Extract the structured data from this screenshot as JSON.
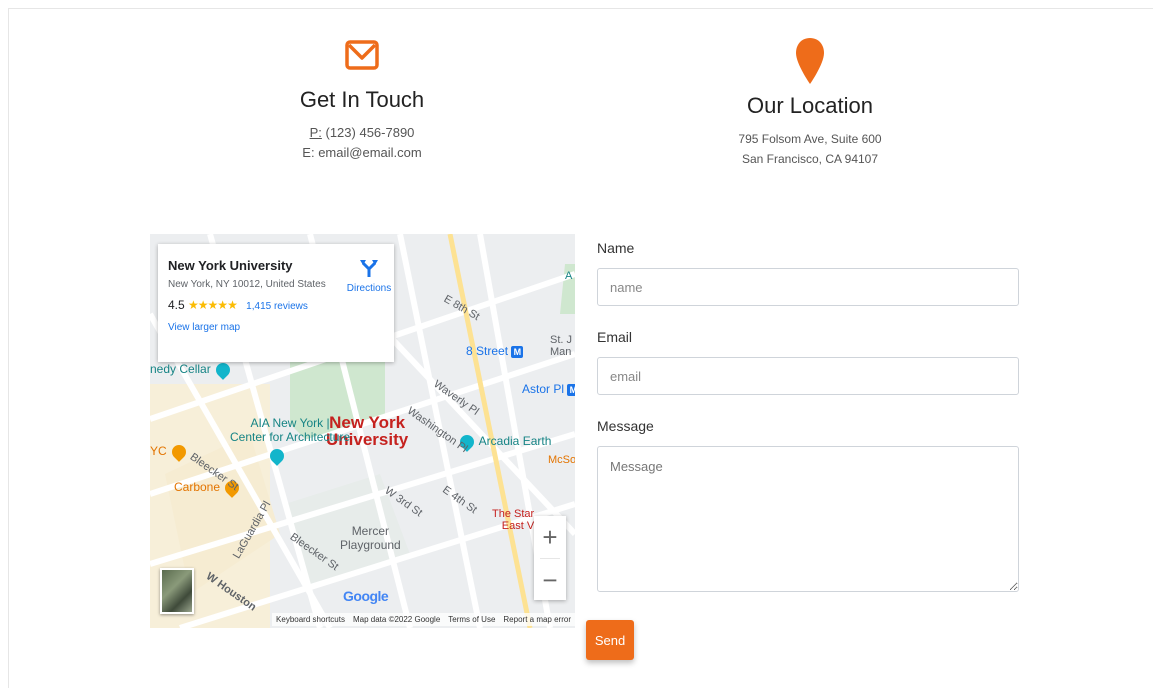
{
  "colors": {
    "accent": "#ee6c1a",
    "link": "#1a73e8"
  },
  "contact": {
    "title": "Get In Touch",
    "phone_label": "P:",
    "phone_value": "(123) 456-7890",
    "email_label": "E:",
    "email_value": "email@email.com",
    "icon": "envelope-icon"
  },
  "location": {
    "title": "Our Location",
    "address_line1": "795 Folsom Ave, Suite 600",
    "address_line2": "San Francisco, CA 94107",
    "icon": "map-pin-icon"
  },
  "map": {
    "card": {
      "title": "New York University",
      "address": "New York, NY 10012, United States",
      "rating": "4.5",
      "stars": "★★★★★",
      "reviews": "1,415 reviews",
      "larger_map": "View larger map",
      "directions": "Directions"
    },
    "labels": {
      "nyu_line1": "New York",
      "nyu_line2": "University",
      "aia_line1": "AIA New York |",
      "aia_line2": "Center for Architecture",
      "arcadia": "Arcadia Earth",
      "carbone": "Carbone",
      "mercer_line1": "Mercer",
      "mercer_line2": "Playground",
      "comedy": "nedy Cellar",
      "eighth_street": "8 Street",
      "astor": "Astor Pl",
      "star_line1": "The Star",
      "star_line2": "East V",
      "st_j_line1": "St. J",
      "st_j_line2": "Man",
      "mcs": "McSo",
      "yc": "YC",
      "a_edge": "A",
      "e8": "E 8th St",
      "waverly": "Waverly Pl",
      "washington": "Washington Pl",
      "bleecker": "Bleecker St",
      "bleecker2": "Bleecker St",
      "w3rd": "W 3rd St",
      "e4th": "E 4th St",
      "laguardia": "LaGuardia Pl",
      "whouston": "W Houston",
      "metro_letter": "M"
    },
    "zoom_in": "+",
    "zoom_out": "−",
    "google": "Google",
    "footer": {
      "shortcuts": "Keyboard shortcuts",
      "data": "Map data ©2022 Google",
      "terms": "Terms of Use",
      "report": "Report a map error"
    }
  },
  "form": {
    "name_label": "Name",
    "name_placeholder": "name",
    "email_label": "Email",
    "email_placeholder": "email",
    "message_label": "Message",
    "message_placeholder": "Message",
    "send_label": "Send"
  }
}
